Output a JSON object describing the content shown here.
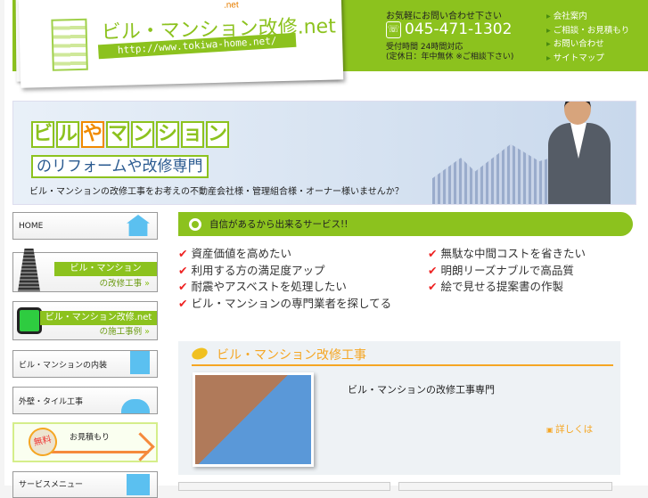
{
  "header": {
    "logo_small": ".net",
    "logo_title": "ビル・マンション改修.net",
    "logo_url": "http://www.tokiwa-home.net/",
    "contact_label": "お気軽にお問い合わせ下さい",
    "phone": "045-471-1302",
    "hours_line1": "受付時間 24時間対応",
    "hours_line2": "(定休日：年中無休 ※ご相談下さい)",
    "nav": [
      "会社案内",
      "ご相談・お見積もり",
      "お問い合わせ",
      "サイトマップ"
    ]
  },
  "banner": {
    "title_chars": [
      "ビ",
      "ル",
      "や",
      "マ",
      "ン",
      "シ",
      "ョ",
      "ン"
    ],
    "subtitle": "のリフォームや改修専門",
    "tagline": "ビル・マンションの改修工事をお考えの不動産会社様・管理組合様・オーナー様いませんか？"
  },
  "sidebar": {
    "home": "HOME",
    "renovation_title": "ビル・マンション",
    "renovation_sub": "の改修工事",
    "cases_title": "ビル・マンション改修.net",
    "cases_sub": "の施工事例",
    "interior": "ビル・マンションの内装",
    "exterior": "外壁・タイル工事",
    "estimate_badge": "無料",
    "estimate": "お見積もり",
    "service_menu": "サービスメニュー"
  },
  "main": {
    "services_heading": "自信があるから出来るサービス!!",
    "checks_left": [
      "資産価値を高めたい",
      "利用する方の満足度アップ",
      "耐震やアスベストを処理したい",
      "ビル・マンションの専門業者を探してる"
    ],
    "checks_right": [
      "無駄な中間コストを省きたい",
      "明朗リーズナブルで高品質",
      "絵で見せる提案書の作製"
    ],
    "section_title": "ビル・マンション改修工事",
    "section_heading": "ビル・マンションの改修工事専門",
    "more_link": "詳しくは"
  }
}
